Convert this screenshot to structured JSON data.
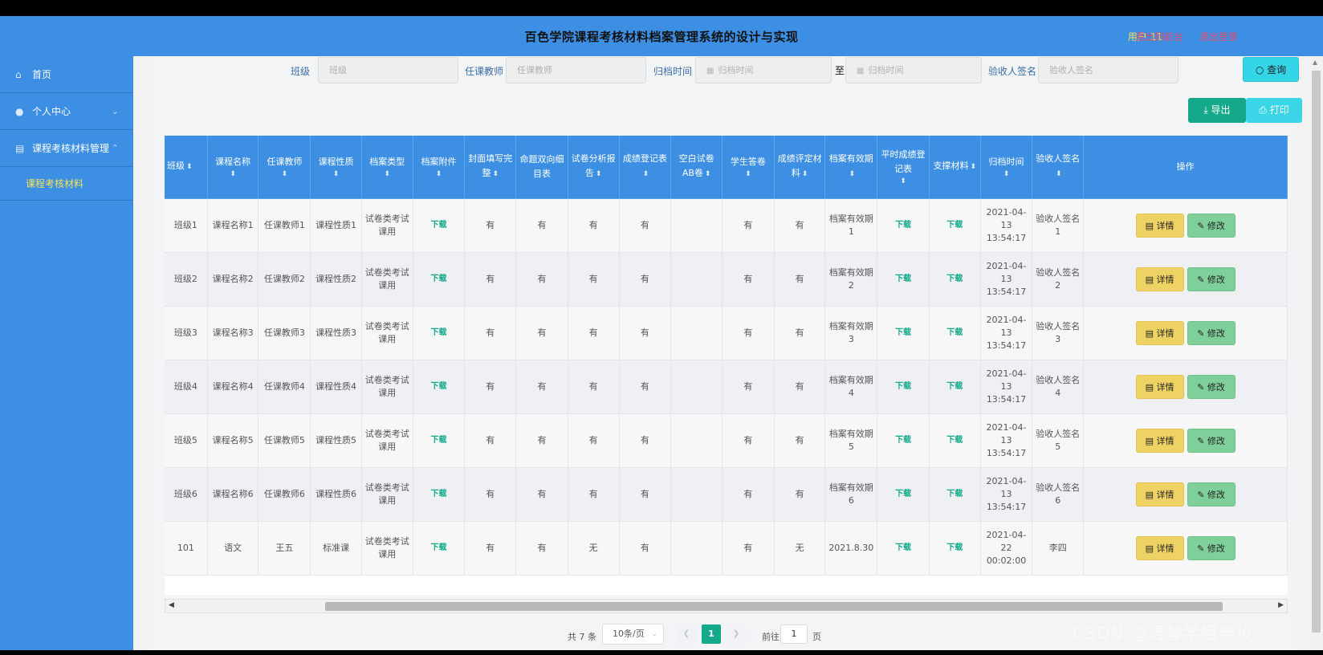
{
  "header": {
    "title": "百色学院课程考核材料档案管理系统的设计与实现",
    "user_label": "用户 11",
    "back_link": "退出到前台",
    "logout_link": "退出登录"
  },
  "sidebar": {
    "items": [
      {
        "label": "首页",
        "icon": "home-icon"
      },
      {
        "label": "个人中心",
        "icon": "user-icon"
      },
      {
        "label": "课程考核材料管理",
        "icon": "clipboard-icon"
      }
    ],
    "sub_item": "课程考核材料"
  },
  "filters": {
    "class_label": "班级",
    "class_placeholder": "班级",
    "teacher_label": "任课教师",
    "teacher_placeholder": "任课教师",
    "archive_label": "归档时间",
    "archive_from_placeholder": "归档时间",
    "to_label": "至",
    "archive_to_placeholder": "归档时间",
    "receiver_label": "验收人签名",
    "receiver_placeholder": "验收人签名",
    "search_button": "查询"
  },
  "toolbar": {
    "export_button": "导出",
    "print_button": "打印"
  },
  "table": {
    "columns": [
      "班级",
      "课程名称",
      "任课教师",
      "课程性质",
      "档案类型",
      "档案附件",
      "封面填写完整",
      "命题双向细目表",
      "试卷分析报告",
      "成绩登记表",
      "空白试卷AB卷",
      "学生答卷",
      "成绩评定材料",
      "档案有效期",
      "平时成绩登记表",
      "支撑材料",
      "归档时间",
      "验收人签名",
      "操作"
    ],
    "detail_button": "详情",
    "edit_button": "修改",
    "rows": [
      [
        "班级1",
        "课程名称1",
        "任课教师1",
        "课程性质1",
        "试卷类考试课用",
        "下载",
        "有",
        "有",
        "有",
        "有",
        "",
        "有",
        "有",
        "档案有效期1",
        "下载",
        "下载",
        "2021-04-13 13:54:17",
        "验收人签名1"
      ],
      [
        "班级2",
        "课程名称2",
        "任课教师2",
        "课程性质2",
        "试卷类考试课用",
        "下载",
        "有",
        "有",
        "有",
        "有",
        "",
        "有",
        "有",
        "档案有效期2",
        "下载",
        "下载",
        "2021-04-13 13:54:17",
        "验收人签名2"
      ],
      [
        "班级3",
        "课程名称3",
        "任课教师3",
        "课程性质3",
        "试卷类考试课用",
        "下载",
        "有",
        "有",
        "有",
        "有",
        "",
        "有",
        "有",
        "档案有效期3",
        "下载",
        "下载",
        "2021-04-13 13:54:17",
        "验收人签名3"
      ],
      [
        "班级4",
        "课程名称4",
        "任课教师4",
        "课程性质4",
        "试卷类考试课用",
        "下载",
        "有",
        "有",
        "有",
        "有",
        "",
        "有",
        "有",
        "档案有效期4",
        "下载",
        "下载",
        "2021-04-13 13:54:17",
        "验收人签名4"
      ],
      [
        "班级5",
        "课程名称5",
        "任课教师5",
        "课程性质5",
        "试卷类考试课用",
        "下载",
        "有",
        "有",
        "有",
        "有",
        "",
        "有",
        "有",
        "档案有效期5",
        "下载",
        "下载",
        "2021-04-13 13:54:17",
        "验收人签名5"
      ],
      [
        "班级6",
        "课程名称6",
        "任课教师6",
        "课程性质6",
        "试卷类考试课用",
        "下载",
        "有",
        "有",
        "有",
        "有",
        "",
        "有",
        "有",
        "档案有效期6",
        "下载",
        "下载",
        "2021-04-13 13:54:17",
        "验收人签名6"
      ],
      [
        "101",
        "语文",
        "王五",
        "标准课",
        "试卷类考试课用",
        "下载",
        "有",
        "有",
        "无",
        "有",
        "",
        "有",
        "无",
        "2021.8.30",
        "下载",
        "下载",
        "2021-04-22 00:02:00",
        "李四"
      ]
    ]
  },
  "pagination": {
    "total": "共 7 条",
    "page_size": "10条/页",
    "current_page": "1",
    "goto_label": "前往",
    "goto_value": "1",
    "page_suffix": "页"
  },
  "watermark": "CSDN @语琴学姐毕设",
  "colors": {
    "primary": "#3c8fe3",
    "accent_green": "#14a98a",
    "accent_cyan": "#34d5e6",
    "detail_yellow": "#efd264",
    "edit_green": "#7fcf9a",
    "menu_highlight": "#f7e55a"
  }
}
